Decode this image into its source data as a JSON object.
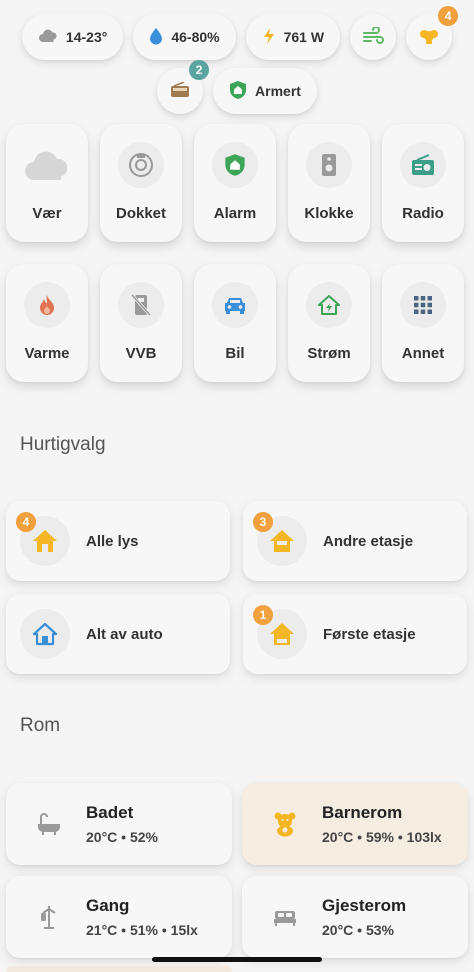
{
  "status_chips": {
    "temperature": "14-23°",
    "humidity": "46-80%",
    "power": "761 W",
    "wind": "",
    "alert_badge": "4",
    "radio_badge": "2",
    "alarm_state": "Armert"
  },
  "tiles": [
    {
      "label": "Vær",
      "icon": "cloud-icon"
    },
    {
      "label": "Dokket",
      "icon": "robot-vacuum-icon"
    },
    {
      "label": "Alarm",
      "icon": "shield-home-icon"
    },
    {
      "label": "Klokke",
      "icon": "speaker-icon"
    },
    {
      "label": "Radio",
      "icon": "radio-icon"
    },
    {
      "label": "Varme",
      "icon": "flame-icon"
    },
    {
      "label": "VVB",
      "icon": "water-heater-off-icon"
    },
    {
      "label": "Bil",
      "icon": "car-icon"
    },
    {
      "label": "Strøm",
      "icon": "home-lightning-icon"
    },
    {
      "label": "Annet",
      "icon": "grid-icon"
    }
  ],
  "quick_title": "Hurtigvalg",
  "quick": [
    {
      "label": "Alle lys",
      "badge": "4",
      "icon": "home-icon"
    },
    {
      "label": "Andre etasje",
      "badge": "3",
      "icon": "home-floor-icon"
    },
    {
      "label": "Alt av auto",
      "badge": "",
      "icon": "home-outline-icon"
    },
    {
      "label": "Første etasje",
      "badge": "1",
      "icon": "home-floor-icon"
    }
  ],
  "rooms_title": "Rom",
  "rooms": [
    {
      "name": "Badet",
      "stats": "20°C • 52%",
      "icon": "bathtub-icon"
    },
    {
      "name": "Barnerom",
      "stats": "20°C • 59% • 103lx",
      "icon": "teddy-bear-icon"
    },
    {
      "name": "Gang",
      "stats": "21°C • 51% • 15lx",
      "icon": "coat-rack-icon"
    },
    {
      "name": "Gjesterom",
      "stats": "20°C • 53%",
      "icon": "bed-icon"
    }
  ],
  "colors": {
    "accent_orange": "#f0a03c",
    "accent_teal": "#5aa5a0",
    "green": "#3da558",
    "blue": "#3b8fd9",
    "yellow": "#f5b623"
  }
}
